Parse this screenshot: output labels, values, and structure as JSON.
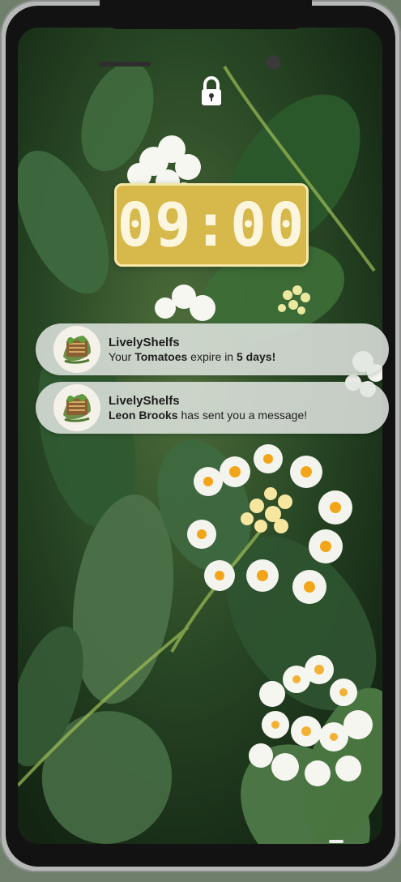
{
  "lock_screen": {
    "time": "09:00"
  },
  "notifications": [
    {
      "app": "LivelyShelfs",
      "message": {
        "before": "Your ",
        "highlight_1": "Tomatoes",
        "middle": " expire in ",
        "highlight_2": "5 days!",
        "after": ""
      }
    },
    {
      "app": "LivelyShelfs",
      "message": {
        "before": "",
        "highlight_1": "Leon Brooks",
        "middle": " has sent you a message!",
        "highlight_2": "",
        "after": ""
      }
    }
  ],
  "icons": {
    "lock": "lock-icon",
    "app": "app-logo-icon"
  },
  "colors": {
    "clock_background": "#d7b84a",
    "clock_border": "#f5e7a7",
    "notification_background": "#e1e5e1",
    "phone_frame": "#b7b9b8"
  }
}
